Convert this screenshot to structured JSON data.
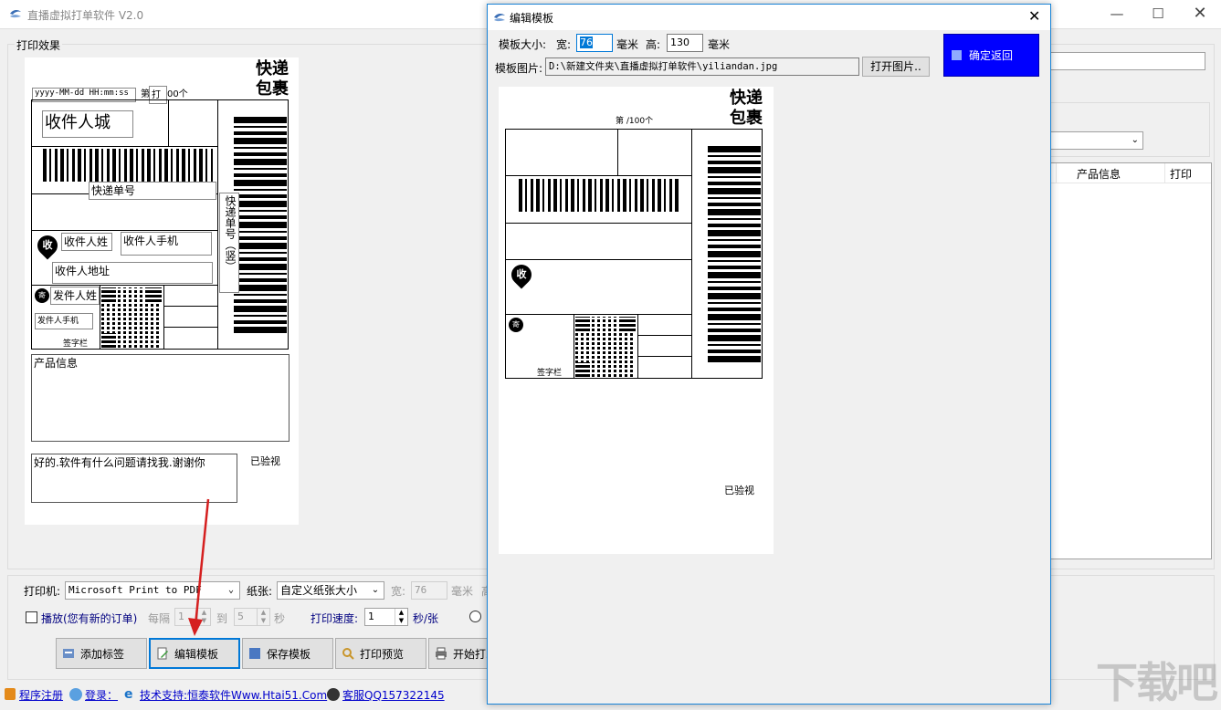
{
  "app": {
    "title": "直播虚拟打单软件 V2.0",
    "print_effect_label": "打印效果"
  },
  "label_preview": {
    "kuaidi_top": "快递",
    "kuaidi_bottom": "包裹",
    "datetime_field": "yyyy-MM-dd HH:mm:ss",
    "print_prefix": "第",
    "print_btn": "打",
    "print_suffix": "00个",
    "receiver_city": "收件人城",
    "tracking_no": "快递单号",
    "tracking_no_vertical": "快递单号（竖）",
    "receive_badge": "收",
    "receiver_name": "收件人姓",
    "receiver_phone": "收件人手机",
    "receiver_address": "收件人地址",
    "send_badge": "寄",
    "sender_name": "发件人姓",
    "sender_phone": "发件人手机",
    "signature": "签字栏",
    "product_info": "产品信息",
    "message": "好的.软件有什么问题请找我.谢谢你",
    "inspected": "已验视"
  },
  "right_panel": {
    "col_product": "产品信息",
    "col_print": "打印"
  },
  "controls": {
    "printer_label": "打印机:",
    "printer_value": "Microsoft Print to PDF",
    "paper_label": "纸张:",
    "paper_value": "自定义纸张大小",
    "width_label": "宽:",
    "width_value": "76",
    "mm_label": "毫米",
    "height_label_partial": "高",
    "play_label": "播放(您有新的订单)",
    "interval_label": "每隔",
    "interval_from": "1",
    "to_label": "到",
    "interval_to": "5",
    "sec_label": "秒",
    "speed_label": "打印速度:",
    "speed_value": "1",
    "speed_unit": "秒/张"
  },
  "buttons": {
    "add_tag": "添加标签",
    "edit_template": "编辑模板",
    "save_template": "保存模板",
    "print_preview": "打印预览",
    "start_print": "开始打印"
  },
  "status_bar": {
    "register": "程序注册",
    "login": "登录：",
    "support": "技术支持:恒泰软件Www.Htai51.Com",
    "service": "客服QQ157322145"
  },
  "dialog": {
    "title": "编辑模板",
    "size_label": "模板大小:",
    "width_label": "宽:",
    "width_value": "76",
    "mm1": "毫米",
    "height_label": "高:",
    "height_value": "130",
    "mm2": "毫米",
    "image_label": "模板图片:",
    "image_path": "D:\\新建文件夹\\直播虚拟打单软件\\yiliandan.jpg",
    "open_image": "打开图片..",
    "confirm": "确定返回",
    "preview": {
      "kuaidi_top": "快递",
      "kuaidi_bottom": "包裹",
      "count_text": "第  /100个",
      "receive_badge": "收",
      "send_badge": "寄",
      "signature": "签字栏",
      "inspected": "已验视"
    }
  },
  "watermark": "下载吧"
}
